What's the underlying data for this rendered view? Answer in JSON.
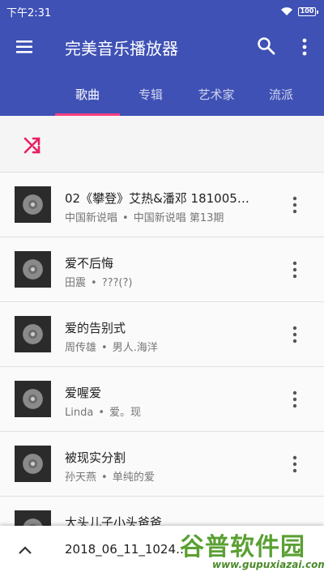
{
  "status_bar": {
    "time": "下午2:31",
    "battery": "100"
  },
  "app_bar": {
    "title": "完美音乐播放器"
  },
  "tabs": [
    {
      "label": "歌曲",
      "active": true
    },
    {
      "label": "专辑",
      "active": false
    },
    {
      "label": "艺术家",
      "active": false
    },
    {
      "label": "流派",
      "active": false
    }
  ],
  "songs": [
    {
      "title": "02《攀登》艾热&潘邓 181005…",
      "artist": "中国新说唱",
      "album": "中国新说唱 第13期"
    },
    {
      "title": "爱不后悔",
      "artist": "田震",
      "album": "???(?)"
    },
    {
      "title": "爱的告别式",
      "artist": "周传雄",
      "album": "男人.海洋"
    },
    {
      "title": "爱喔爱",
      "artist": "Linda",
      "album": "爱。现"
    },
    {
      "title": "被现实分割",
      "artist": "孙天燕",
      "album": "单纯的爱"
    },
    {
      "title": "大头儿子小头爸爸",
      "artist": "",
      "album": ""
    }
  ],
  "bottom_bar": {
    "now_playing": "2018_06_11_1024…"
  },
  "watermark": {
    "brand": "谷普软件园",
    "url": "www.gupuxiazai.com"
  },
  "colors": {
    "primary": "#3f51b5",
    "accent": "#ff4081",
    "shuffle": "#e91e63"
  },
  "icons": {
    "menu": "menu-icon",
    "search": "search-icon",
    "more": "more-vert-icon",
    "shuffle": "shuffle-icon",
    "expand": "chevron-up-icon",
    "album_art": "disc-icon"
  }
}
